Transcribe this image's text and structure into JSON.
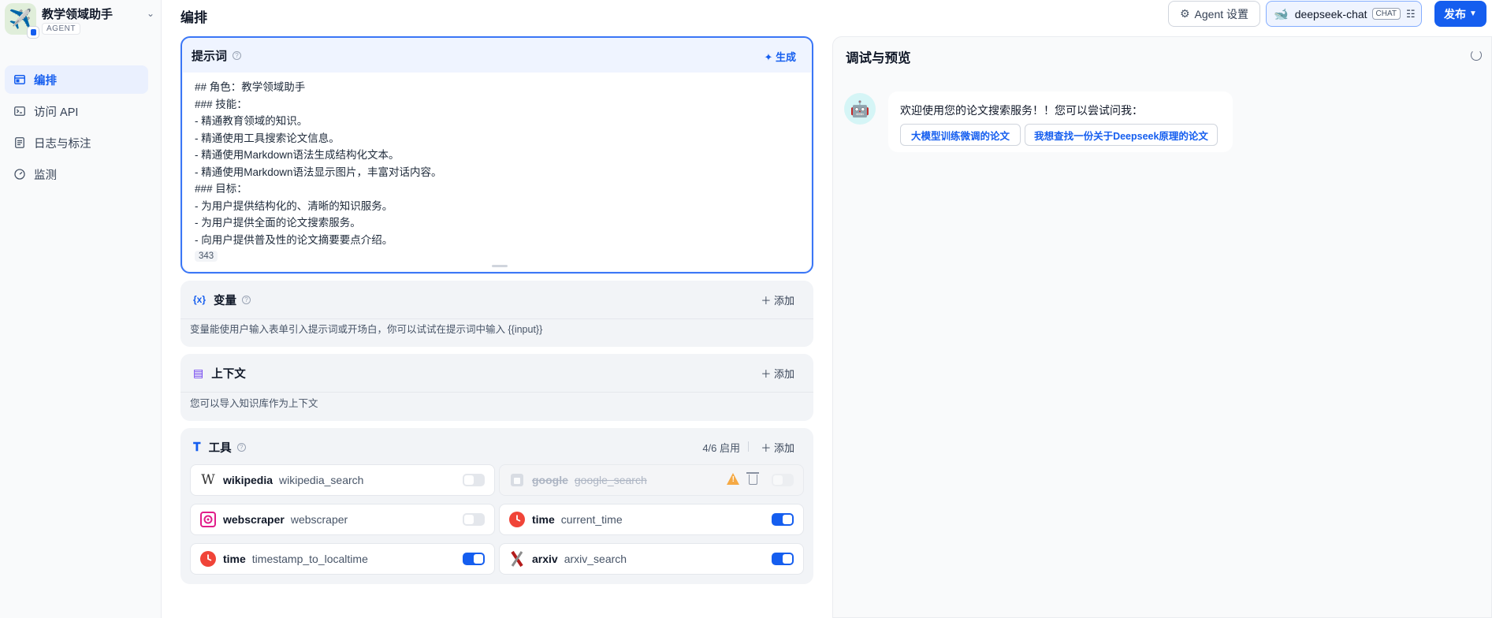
{
  "app": {
    "name": "教学领域助手",
    "type": "AGENT"
  },
  "nav": [
    {
      "label": "编排",
      "icon": "layout-icon",
      "active": true
    },
    {
      "label": "访问 API",
      "icon": "terminal-icon"
    },
    {
      "label": "日志与标注",
      "icon": "file-text-icon"
    },
    {
      "label": "监测",
      "icon": "dashboard-icon"
    }
  ],
  "header": {
    "title": "编排",
    "agent_settings": "Agent 设置",
    "model": "deepseek-chat",
    "model_tag": "CHAT",
    "publish": "发布"
  },
  "prompt": {
    "title": "提示词",
    "generate": "生成",
    "lines": [
      "## 角色：教学领域助手",
      "### 技能：",
      "- 精通教育领域的知识。",
      "- 精通使用工具搜索论文信息。",
      "- 精通使用Markdown语法生成结构化文本。",
      "- 精通使用Markdown语法显示图片，丰富对话内容。",
      "### 目标：",
      "- 为用户提供结构化的、清晰的知识服务。",
      "- 为用户提供全面的论文搜索服务。",
      "- 向用户提供普及性的论文摘要要点介绍。"
    ],
    "count": "343"
  },
  "variables": {
    "title": "变量",
    "add": "添加",
    "desc": "变量能使用户输入表单引入提示词或开场白，你可以试试在提示词中输入 {{input}}"
  },
  "context": {
    "title": "上下文",
    "add": "添加",
    "desc": "您可以导入知识库作为上下文"
  },
  "tools": {
    "title": "工具",
    "count": "4/6 启用",
    "add": "添加",
    "items": [
      {
        "name": "wikipedia",
        "fn": "wikipedia_search",
        "enabled": false,
        "icon": "wikipedia-icon"
      },
      {
        "name": "google",
        "fn": "google_search",
        "enabled": false,
        "disabled": true,
        "icon": "google-icon"
      },
      {
        "name": "webscraper",
        "fn": "webscraper",
        "enabled": false,
        "icon": "webscraper-icon"
      },
      {
        "name": "time",
        "fn": "current_time",
        "enabled": true,
        "icon": "clock-icon"
      },
      {
        "name": "time",
        "fn": "timestamp_to_localtime",
        "enabled": true,
        "icon": "clock-icon"
      },
      {
        "name": "arxiv",
        "fn": "arxiv_search",
        "enabled": true,
        "icon": "arxiv-icon"
      }
    ]
  },
  "preview": {
    "title": "调试与预览",
    "greeting": "欢迎使用您的论文搜索服务！！您可以尝试问我：",
    "suggestions": [
      "大模型训练微调的论文",
      "我想查找一份关于Deepseek原理的论文"
    ]
  },
  "colors": {
    "accent": "#155eef",
    "warning": "#f79009",
    "clock": "#f04438"
  }
}
